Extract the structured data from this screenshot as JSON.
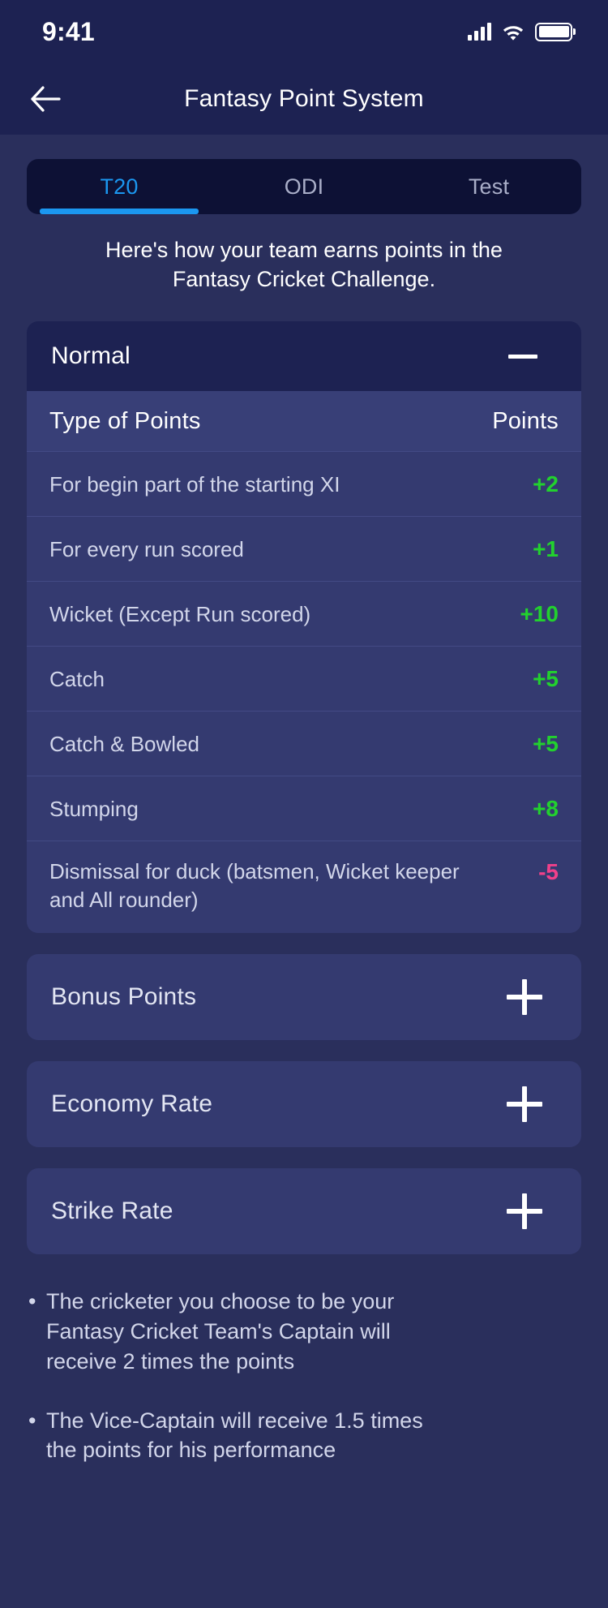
{
  "status_bar": {
    "time": "9:41",
    "signal_icon": "signal-bars-icon",
    "wifi_icon": "wifi-icon",
    "battery_icon": "battery-full-icon"
  },
  "nav": {
    "back_icon": "arrow-left-icon",
    "title": "Fantasy Point System"
  },
  "tabs": [
    {
      "label": "T20",
      "active": true
    },
    {
      "label": "ODI",
      "active": false
    },
    {
      "label": "Test",
      "active": false
    }
  ],
  "subtitle": "Here's how  your team earns points in the Fantasy Cricket Challenge.",
  "normal_section": {
    "title": "Normal",
    "toggle_icon": "minus-icon",
    "expanded": true,
    "table": {
      "columns": [
        "Type of Points",
        "Points"
      ],
      "rows": [
        {
          "type": "For begin part of the starting XI",
          "points": "+2",
          "sign": "pos"
        },
        {
          "type": "For every run scored",
          "points": "+1",
          "sign": "pos"
        },
        {
          "type": "Wicket (Except Run scored)",
          "points": "+10",
          "sign": "pos"
        },
        {
          "type": "Catch",
          "points": "+5",
          "sign": "pos"
        },
        {
          "type": "Catch & Bowled",
          "points": "+5",
          "sign": "pos"
        },
        {
          "type": "Stumping",
          "points": "+8",
          "sign": "pos"
        },
        {
          "type": "Dismissal for duck (batsmen, Wicket keeper and All rounder)",
          "points": "-5",
          "sign": "neg"
        }
      ]
    }
  },
  "collapsed_sections": [
    {
      "title": "Bonus Points",
      "toggle_icon": "plus-icon"
    },
    {
      "title": "Economy Rate",
      "toggle_icon": "plus-icon"
    },
    {
      "title": "Strike Rate",
      "toggle_icon": "plus-icon"
    }
  ],
  "notes": [
    {
      "bullet": "•",
      "text": "The cricketer you choose to be your Fantasy Cricket Team's Captain will receive 2 times the points"
    },
    {
      "bullet": "•",
      "text": "The Vice-Captain will receive 1.5 times the points for his performance"
    }
  ],
  "colors": {
    "background": "#2a2f5c",
    "header_bg": "#1d2252",
    "accent_blue": "#1b97f0",
    "positive_green": "#22d12e",
    "negative_pink": "#f0408a"
  }
}
